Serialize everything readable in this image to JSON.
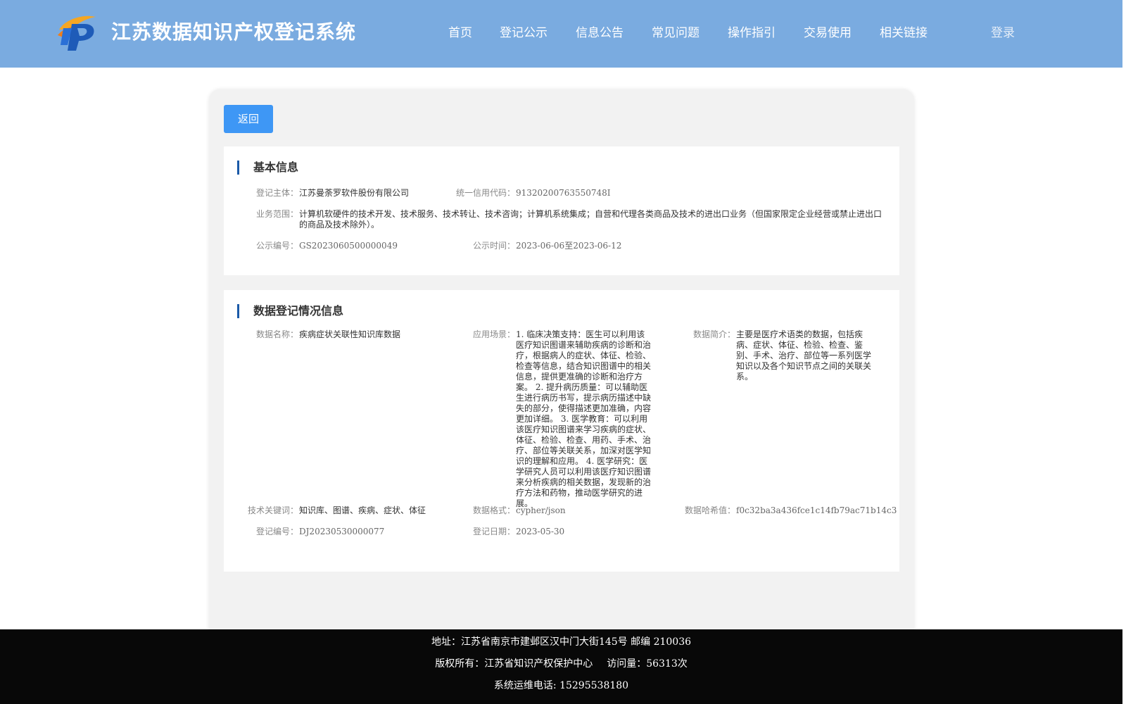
{
  "header": {
    "site_title": "江苏数据知识产权登记系统",
    "logo_icon": "pp-logo-icon",
    "nav": [
      "首页",
      "登记公示",
      "信息公告",
      "常见问题",
      "操作指引",
      "交易使用",
      "相关链接"
    ],
    "login_label": "登录"
  },
  "card": {
    "back_label": "返回",
    "basic": {
      "title": "基本信息",
      "entity_label": "登记主体：",
      "entity_value": "江苏曼荼罗软件股份有限公司",
      "credit_label": "统一信用代码：",
      "credit_value": "91320200763550748I",
      "scope_label": "业务范围：",
      "scope_value": "计算机软硬件的技术开发、技术服务、技术转让、技术咨询；计算机系统集成；自营和代理各类商品及技术的进出口业务（但国家限定企业经营或禁止进出口的商品及技术除外）。",
      "notice_no_label": "公示编号：",
      "notice_no_value": "GS2023060500000049",
      "notice_time_label": "公示时间：",
      "notice_time_value": "2023-06-06至2023-06-12"
    },
    "registration": {
      "title": "数据登记情况信息",
      "data_name_label": "数据名称：",
      "data_name_value": "疾病症状关联性知识库数据",
      "scenario_label": "应用场景：",
      "scenario_value": "1. 临床决策支持：医生可以利用该医疗知识图谱来辅助疾病的诊断和治疗，根据病人的症状、体征、检验、检查等信息，结合知识图谱中的相关信息，提供更准确的诊断和治疗方案。 2. 提升病历质量：可以辅助医生进行病历书写，提示病历描述中缺失的部分，使得描述更加准确，内容更加详细。 3. 医学教育：可以利用该医疗知识图谱来学习疾病的症状、体征、检验、检查、用药、手术、治疗、部位等关联关系，加深对医学知识的理解和应用。 4. 医学研究：医学研究人员可以利用该医疗知识图谱来分析疾病的相关数据，发现新的治疗方法和药物，推动医学研究的进展。",
      "summary_label": "数据简介：",
      "summary_value": "主要是医疗术语类的数据，包括疾病、症状、体征、检验、检查、鉴别、手术、治疗、部位等一系列医学知识以及各个知识节点之间的关联关系。",
      "keywords_label": "技术关键词：",
      "keywords_value": "知识库、图谱、疾病、症状、体征",
      "format_label": "数据格式：",
      "format_value": "cypher/json",
      "hash_label": "数据哈希值：",
      "hash_value": "f0c32ba3a436fce1c14fb79ac71b14c3",
      "reg_no_label": "登记编号：",
      "reg_no_value": "DJ20230530000077",
      "reg_date_label": "登记日期：",
      "reg_date_value": "2023-05-30"
    }
  },
  "footer": {
    "address": "地址：江苏省南京市建邺区汉中门大街145号 邮编 210036",
    "copyright": "版权所有：江苏省知识产权保护中心",
    "visits": "访问量：56313次",
    "hotline": "系统运维电话: 15295538180"
  },
  "colors": {
    "header_bg": "#7aabe0",
    "button_blue": "#3e97f5",
    "section_bar": "#1b5aa8",
    "footer_bg": "#080808"
  }
}
